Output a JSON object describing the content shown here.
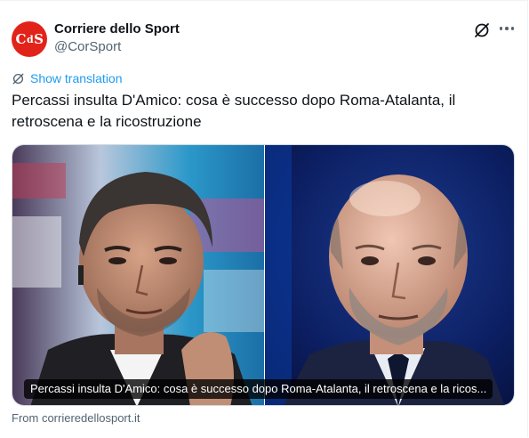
{
  "author": {
    "avatar_text_left": "C",
    "avatar_text_mid": "d",
    "avatar_text_right": "S",
    "name": "Corriere dello Sport",
    "handle": "@CorSport"
  },
  "actions": {
    "grok_icon": "grok-icon",
    "more_icon": "more-options-icon"
  },
  "translate": {
    "label": "Show translation",
    "icon": "translate-icon"
  },
  "tweet": {
    "text": "Percassi insulta D'Amico: cosa è successo dopo Roma-Atalanta, il retroscena e la ricostruzione"
  },
  "card": {
    "caption": "Percassi insulta D'Amico: cosa è successo dopo Roma-Atalanta, il retroscena e la ricos...",
    "source": "From corrieredellosport.it"
  },
  "colors": {
    "accent": "#1d9bf0",
    "brand_red": "#e2231a",
    "secondary_text": "#536471"
  }
}
